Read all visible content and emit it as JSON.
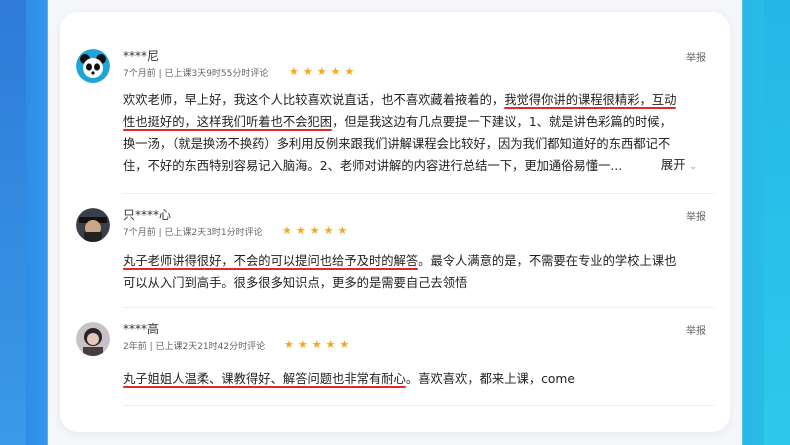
{
  "reviews": [
    {
      "name": "****尼",
      "meta": "7个月前 | 已上课3天9时55分时评论",
      "stars": "★★★★★",
      "report": "举报",
      "line1_pre": "欢欢老师，早上好，我这个人比较喜欢说直话，也不喜欢藏着掖着的，",
      "line1_hl": "我觉得你讲的课程很精彩，互动",
      "line2_hl": "性也挺好的，这样我们听着也不会犯困",
      "line2_post": "，但是我这边有几点要提一下建议，1、就是讲色彩篇的时候，",
      "line3": "换一汤，（就是换汤不换药）多利用反例来跟我们讲解课程会比较好，因为我们都知道好的东西都记不",
      "line4": "住，不好的东西特别容易记入脑海。2、老师对讲解的内容进行总结一下，更加通俗易懂一...",
      "expand": "展开"
    },
    {
      "name": "只****心",
      "meta": "7个月前 | 已上课2天3时1分时评论",
      "stars": "★★★★★",
      "report": "举报",
      "line1_hl": "丸子老师讲得很好，不会的可以提问也给予及时的解答",
      "line1_post": "。最令人满意的是，不需要在专业的学校上课也",
      "line2": "可以从入门到高手。很多很多知识点，更多的是需要自己去领悟"
    },
    {
      "name": "****高",
      "meta": "2年前 | 已上课2天21时42分时评论",
      "stars": "★★★★★",
      "report": "举报",
      "line1_hl": "丸子姐姐人温柔、课教得好、解答问题也非常有耐心",
      "line1_post": "。喜欢喜欢，都来上课，come"
    }
  ]
}
